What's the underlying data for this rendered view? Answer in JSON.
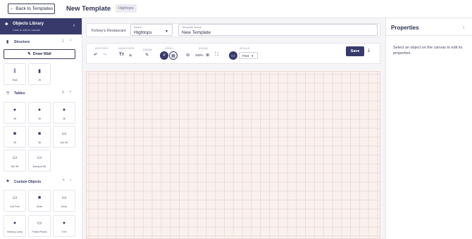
{
  "topbar": {
    "back_label": "Back to Templates",
    "back_icon": "arrow-left-icon",
    "title": "New Template",
    "space_chip": "Hightops"
  },
  "library": {
    "title": "Objects Library",
    "subtitle": "Click to add to canvas",
    "draw_wall_label": "Draw Wall",
    "sections": {
      "structure": {
        "label": "Structure",
        "count": "2"
      },
      "tables": {
        "label": "Tables",
        "count": "8"
      },
      "custom": {
        "label": "Custom Objects"
      }
    },
    "structure_items": [
      {
        "label": "Wall",
        "glyph": "⫼"
      },
      {
        "label": "2ft",
        "glyph": "▮"
      }
    ],
    "table_items": [
      {
        "label": "4ft",
        "glyph": "●"
      },
      {
        "label": "3ft",
        "glyph": "●"
      },
      {
        "label": "2ft",
        "glyph": "●"
      },
      {
        "label": "3ft",
        "glyph": "■"
      },
      {
        "label": "4ft",
        "glyph": "■"
      },
      {
        "label": "6x2.4ft",
        "glyph": "▭"
      },
      {
        "label": "8x2.4ft",
        "glyph": "▭"
      },
      {
        "label": "Banquet 6ft",
        "glyph": "▭"
      }
    ],
    "custom_items": [
      {
        "label": "Cat Tree",
        "glyph": "▭"
      },
      {
        "label": "Chair",
        "glyph": "■"
      },
      {
        "label": "Desk",
        "glyph": "▭"
      },
      {
        "label": "Heating Lamp",
        "glyph": "●"
      },
      {
        "label": "Potted Plants",
        "glyph": "▭"
      },
      {
        "label": "Tree",
        "glyph": "●"
      }
    ]
  },
  "context": {
    "restaurant": "Kelsey's Restaurant",
    "space_label": "Space",
    "space_value": "Hightops",
    "name_label": "Template Name",
    "name_value": "New Template"
  },
  "toolbar": {
    "history_label": "HISTORY",
    "annotate_label": "ANNOTATE",
    "draw_label": "DRAW",
    "grid_label": "GRID",
    "zoom_label": "ZOOM",
    "scale_label": "SCALE",
    "zoom_value": "100%",
    "scale_value": "Feet",
    "save_label": "Save"
  },
  "properties": {
    "title": "Properties",
    "empty_text": "Select an object on the canvas to edit its properties"
  },
  "colors": {
    "brand": "#373a6a",
    "canvas_bg": "#faf1ef",
    "grid_line": "#ecdcd7"
  }
}
